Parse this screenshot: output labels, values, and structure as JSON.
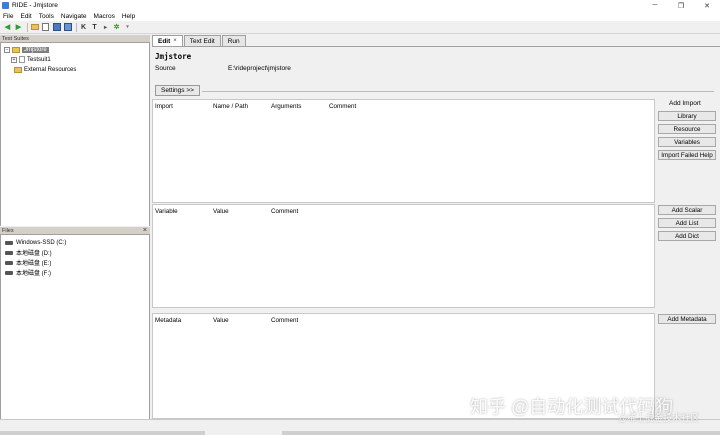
{
  "window": {
    "title": "RIDE - Jmjstore"
  },
  "menu": [
    "File",
    "Edit",
    "Tools",
    "Navigate",
    "Macros",
    "Help"
  ],
  "toolbar_icons": [
    "back-arrow-icon",
    "forward-arrow-icon",
    "open-folder-icon",
    "open-file-icon",
    "save-icon",
    "save-all-icon",
    "keyword-icon",
    "test-icon",
    "run-icon",
    "settings-icon"
  ],
  "test_suites_panel": {
    "header": "Test Suites",
    "root": "Jmjstore",
    "children": [
      "Testsuit1"
    ],
    "external": "External Resources"
  },
  "files_panel": {
    "header": "Files",
    "close": "×",
    "drives": [
      "Windows-SSD (C:)",
      "本地磁盘 (D:)",
      "本地磁盘 (E:)",
      "本地磁盘 (F:)"
    ]
  },
  "tabs": [
    {
      "label": "Edit",
      "active": true,
      "close": "×"
    },
    {
      "label": "Text Edit",
      "active": false
    },
    {
      "label": "Run",
      "active": false
    }
  ],
  "editor": {
    "suite_name": "Jmjstore",
    "source_label": "Source",
    "source_value": "E:\\rideproject\\jmjstore",
    "settings_button": "Settings >>",
    "import_section": {
      "headers": [
        "Import",
        "Name / Path",
        "Arguments",
        "Comment"
      ],
      "side_label": "Add Import",
      "buttons": [
        "Library",
        "Resource",
        "Variables",
        "Import Failed Help"
      ]
    },
    "variable_section": {
      "headers": [
        "Variable",
        "Value",
        "Comment"
      ],
      "buttons": [
        "Add Scalar",
        "Add List",
        "Add Dict"
      ]
    },
    "metadata_section": {
      "headers": [
        "Metadata",
        "Value",
        "Comment"
      ],
      "buttons": [
        "Add Metadata"
      ]
    }
  },
  "watermark": {
    "main": "知乎 @自动化测试代码狗",
    "sub": "@稀土掘金技术社区"
  }
}
